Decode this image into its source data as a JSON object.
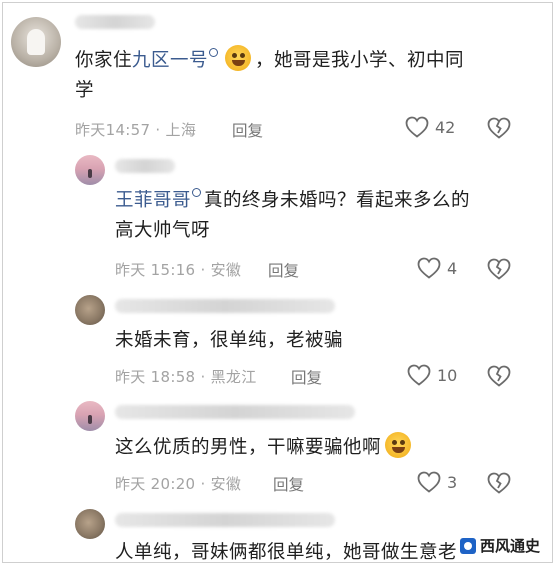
{
  "comments": [
    {
      "mention": "九区一号",
      "text_after": "，她哥是我小学、初中同",
      "text_line2": "学",
      "meta": "昨天14:57 · 上海",
      "reply": "回复",
      "likes": "42"
    },
    {
      "mention": "王菲哥哥",
      "text_after": "真的终身未婚吗？看起来多么的",
      "text_line2": "高大帅气呀",
      "meta": "昨天 15:16 · 安徽",
      "reply": "回复",
      "likes": "4"
    },
    {
      "text": "未婚未育，很单纯，老被骗",
      "meta": "昨天 18:58 · 黑龙江",
      "reply": "回复",
      "likes": "10"
    },
    {
      "text": "这么优质的男性，干嘛要骗他啊",
      "meta": "昨天 20:20 · 安徽",
      "reply": "回复",
      "likes": "3"
    },
    {
      "text": "人单纯，哥妹俩都很单纯，她哥做生意老"
    }
  ],
  "watermark": "西风通史"
}
